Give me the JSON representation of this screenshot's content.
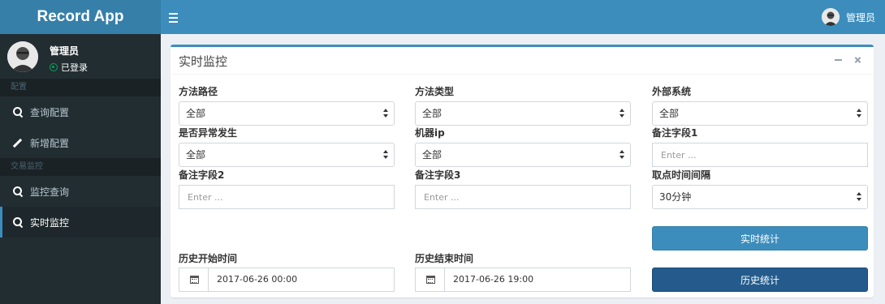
{
  "app": {
    "title": "Record App"
  },
  "header": {
    "user_name": "管理员"
  },
  "sidebar": {
    "user": {
      "name": "管理员",
      "status": "已登录"
    },
    "sections": [
      {
        "header": "配置",
        "items": [
          {
            "label": "查询配置",
            "icon": "search-icon"
          },
          {
            "label": "新增配置",
            "icon": "pencil-icon"
          }
        ]
      },
      {
        "header": "交易监控",
        "items": [
          {
            "label": "监控查询",
            "icon": "search-icon"
          },
          {
            "label": "实时监控",
            "icon": "search-icon",
            "active": true
          }
        ]
      }
    ]
  },
  "panel": {
    "title": "实时监控",
    "fields": {
      "method_path": {
        "label": "方法路径",
        "value": "全部"
      },
      "method_type": {
        "label": "方法类型",
        "value": "全部"
      },
      "external_system": {
        "label": "外部系统",
        "value": "全部"
      },
      "is_exception": {
        "label": "是否异常发生",
        "value": "全部"
      },
      "machine_ip": {
        "label": "机器ip",
        "value": "全部"
      },
      "remark1": {
        "label": "备注字段1",
        "placeholder": "Enter ..."
      },
      "remark2": {
        "label": "备注字段2",
        "placeholder": "Enter ..."
      },
      "remark3": {
        "label": "备注字段3",
        "placeholder": "Enter ..."
      },
      "interval": {
        "label": "取点时间间隔",
        "value": "30分钟"
      },
      "history_start": {
        "label": "历史开始时间",
        "value": "2017-06-26 00:00"
      },
      "history_end": {
        "label": "历史结束时间",
        "value": "2017-06-26 19:00"
      }
    },
    "buttons": {
      "realtime": "实时统计",
      "history": "历史统计"
    }
  },
  "colors": {
    "navbar": "#3c8dbc",
    "logo": "#367fa9",
    "sidebar": "#222d32",
    "history_button": "#245b8c"
  }
}
